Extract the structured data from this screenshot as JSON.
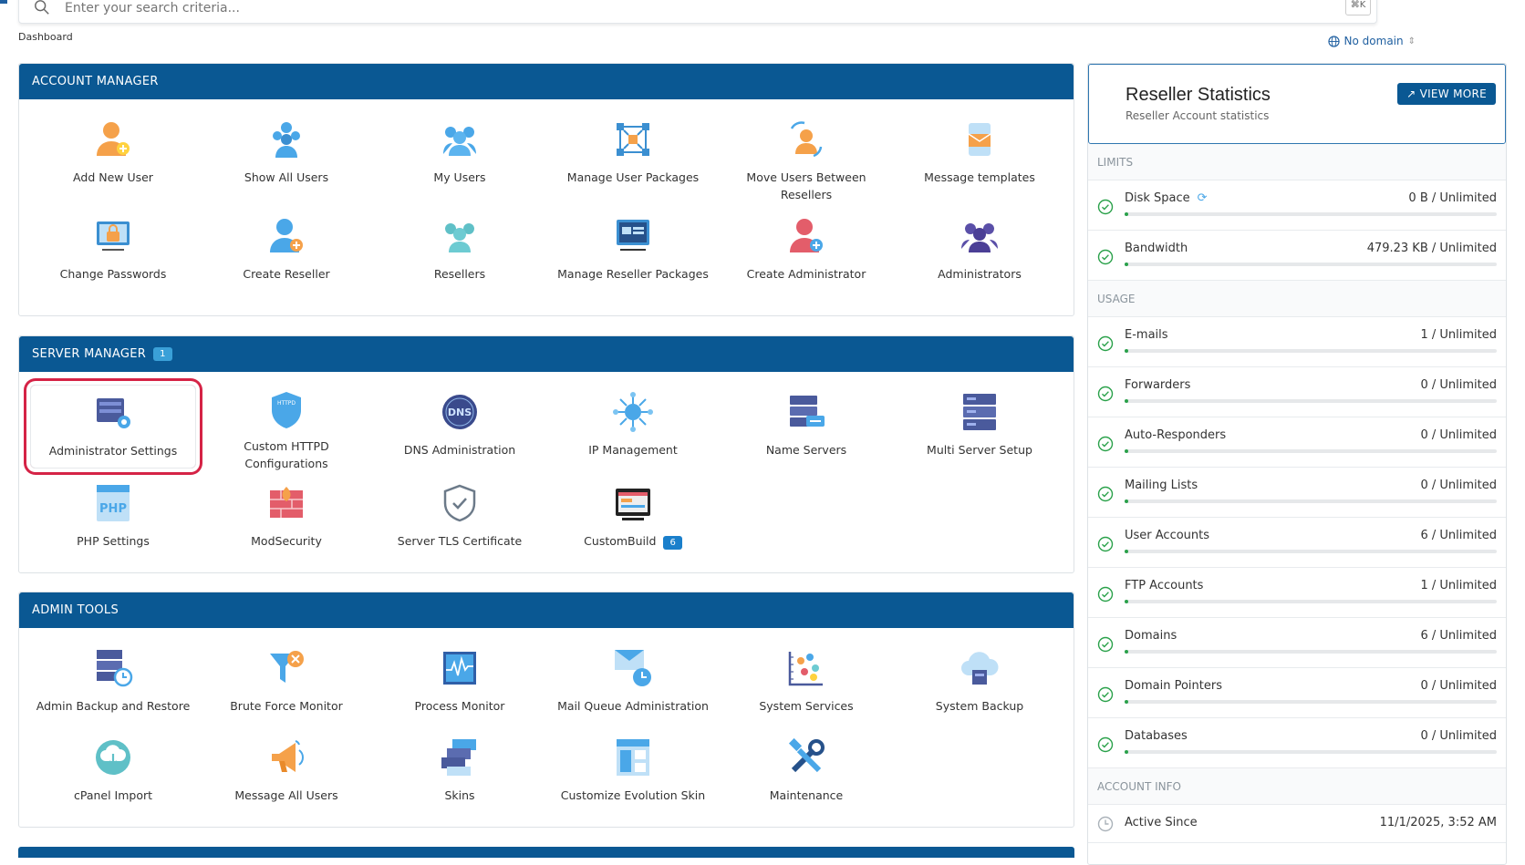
{
  "search": {
    "placeholder": "Enter your search criteria...",
    "shortcut": "⌘K"
  },
  "breadcrumb": "Dashboard",
  "domain_select": {
    "label": "No domain"
  },
  "account_manager": {
    "title": "ACCOUNT MANAGER",
    "items": [
      {
        "label": "Add New User",
        "icon": "add-user-icon"
      },
      {
        "label": "Show All Users",
        "icon": "users-group-icon"
      },
      {
        "label": "My Users",
        "icon": "my-users-icon"
      },
      {
        "label": "Manage User Packages",
        "icon": "packages-network-icon"
      },
      {
        "label": "Move Users Between Resellers",
        "icon": "move-users-icon"
      },
      {
        "label": "Message templates",
        "icon": "message-templates-icon"
      },
      {
        "label": "Change Passwords",
        "icon": "lock-monitor-icon"
      },
      {
        "label": "Create Reseller",
        "icon": "create-reseller-icon"
      },
      {
        "label": "Resellers",
        "icon": "resellers-icon"
      },
      {
        "label": "Manage Reseller Packages",
        "icon": "reseller-packages-icon"
      },
      {
        "label": "Create Administrator",
        "icon": "create-admin-icon"
      },
      {
        "label": "Administrators",
        "icon": "administrators-icon"
      }
    ]
  },
  "server_manager": {
    "title": "SERVER MANAGER",
    "badge": "1",
    "items": [
      {
        "label": "Administrator Settings",
        "icon": "admin-settings-icon"
      },
      {
        "label": "Custom HTTPD Configurations",
        "icon": "httpd-shield-icon"
      },
      {
        "label": "DNS Administration",
        "icon": "dns-globe-icon"
      },
      {
        "label": "IP Management",
        "icon": "ip-network-icon"
      },
      {
        "label": "Name Servers",
        "icon": "name-servers-icon"
      },
      {
        "label": "Multi Server Setup",
        "icon": "multi-server-icon"
      },
      {
        "label": "PHP Settings",
        "icon": "php-icon"
      },
      {
        "label": "ModSecurity",
        "icon": "firewall-icon"
      },
      {
        "label": "Server TLS Certificate",
        "icon": "tls-shield-icon"
      },
      {
        "label": "CustomBuild",
        "icon": "custombuild-icon",
        "badge": "6"
      }
    ]
  },
  "admin_tools": {
    "title": "ADMIN TOOLS",
    "items": [
      {
        "label": "Admin Backup and Restore",
        "icon": "backup-restore-icon"
      },
      {
        "label": "Brute Force Monitor",
        "icon": "funnel-icon"
      },
      {
        "label": "Process Monitor",
        "icon": "process-monitor-icon"
      },
      {
        "label": "Mail Queue Administration",
        "icon": "mail-queue-icon"
      },
      {
        "label": "System Services",
        "icon": "system-services-icon"
      },
      {
        "label": "System Backup",
        "icon": "cloud-backup-icon"
      },
      {
        "label": "cPanel Import",
        "icon": "cloud-download-icon"
      },
      {
        "label": "Message All Users",
        "icon": "megaphone-icon"
      },
      {
        "label": "Skins",
        "icon": "skins-icon"
      },
      {
        "label": "Customize Evolution Skin",
        "icon": "customize-skin-icon"
      },
      {
        "label": "Maintenance",
        "icon": "tools-icon"
      }
    ]
  },
  "stats": {
    "title": "Reseller Statistics",
    "subtitle": "Reseller Account statistics",
    "view_more": "VIEW MORE",
    "limits_label": "LIMITS",
    "limits": [
      {
        "name": "Disk Space",
        "value": "0 B / Unlimited",
        "refresh": true
      },
      {
        "name": "Bandwidth",
        "value": "479.23 KB / Unlimited"
      }
    ],
    "usage_label": "USAGE",
    "usage": [
      {
        "name": "E-mails",
        "value": "1 / Unlimited"
      },
      {
        "name": "Forwarders",
        "value": "0 / Unlimited"
      },
      {
        "name": "Auto-Responders",
        "value": "0 / Unlimited"
      },
      {
        "name": "Mailing Lists",
        "value": "0 / Unlimited"
      },
      {
        "name": "User Accounts",
        "value": "6 / Unlimited"
      },
      {
        "name": "FTP Accounts",
        "value": "1 / Unlimited"
      },
      {
        "name": "Domains",
        "value": "6 / Unlimited"
      },
      {
        "name": "Domain Pointers",
        "value": "0 / Unlimited"
      },
      {
        "name": "Databases",
        "value": "0 / Unlimited"
      }
    ],
    "account_info_label": "ACCOUNT INFO",
    "account_info": [
      {
        "name": "Active Since",
        "value": "11/1/2025, 3:52 AM"
      }
    ]
  },
  "colors": {
    "header": "#0a5893",
    "accent": "#1a7fcb",
    "selected_ring": "#d52346",
    "progress": "#2aa14a"
  }
}
